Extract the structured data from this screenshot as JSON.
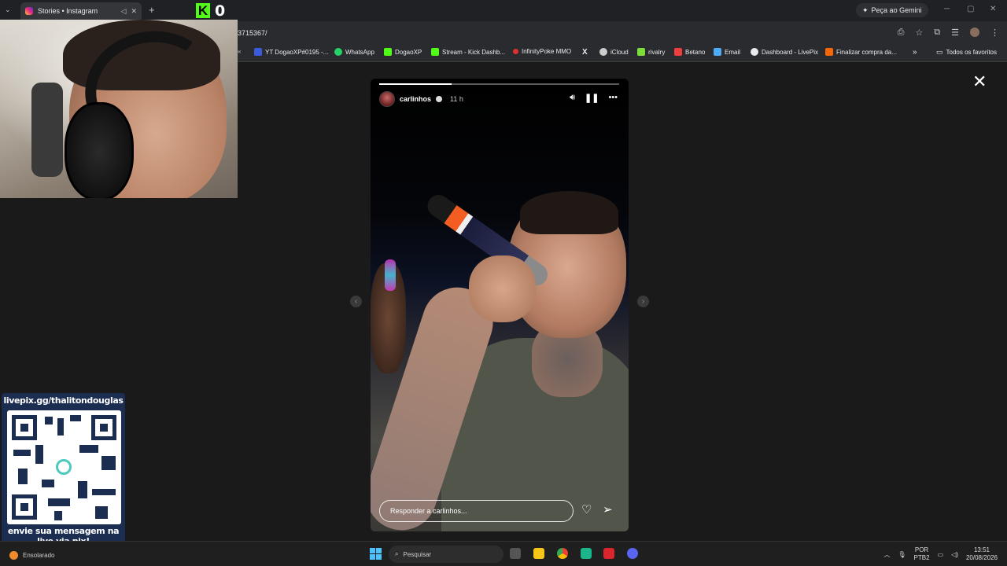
{
  "browser": {
    "tab_title": "Stories • Instagram",
    "gemini_label": "Peça ao Gemini",
    "url": "3715367/",
    "bookmarks": [
      {
        "label": "YT DogaoXP#0195 -...",
        "color": "#3b5bdb"
      },
      {
        "label": "WhatsApp",
        "color": "#25d366"
      },
      {
        "label": "DogaoXP",
        "color": "#53fc18"
      },
      {
        "label": "Stream - Kick Dashb...",
        "color": "#53fc18"
      },
      {
        "label": "InfinityPoke MMO",
        "color": "#e03131"
      },
      {
        "label": "",
        "color": "#ffffff"
      },
      {
        "label": "iCloud",
        "color": "#cccccc"
      },
      {
        "label": "rivalry",
        "color": "#7bdc3a"
      },
      {
        "label": "Betano",
        "color": "#f03e3e"
      },
      {
        "label": "Email",
        "color": "#4dabf7"
      },
      {
        "label": "Dashboard - LivePix",
        "color": "#e8eaed"
      },
      {
        "label": "Finalizar compra da...",
        "color": "#f76707"
      }
    ],
    "favorites_label": "Todos os favoritos"
  },
  "stream_overlay": {
    "kick_count": "0",
    "livepix_url": "livepix.gg/thalitondouglas",
    "livepix_message": "envie sua mensagem na live via pix!"
  },
  "story": {
    "username": "carlinhos",
    "time_ago": "11 h",
    "progress": 0.3,
    "reply_placeholder": "Responder a carlinhos..."
  },
  "taskbar": {
    "weather": "Ensolarado",
    "search_placeholder": "Pesquisar",
    "lang_line1": "POR",
    "lang_line2": "PTB2",
    "time": "13:51",
    "date": "20/08/2026"
  },
  "colors": {
    "accent_kick": "#53fc18",
    "livepix_bg": "#1c2d52",
    "windows_blue": "#4cc2ff"
  }
}
